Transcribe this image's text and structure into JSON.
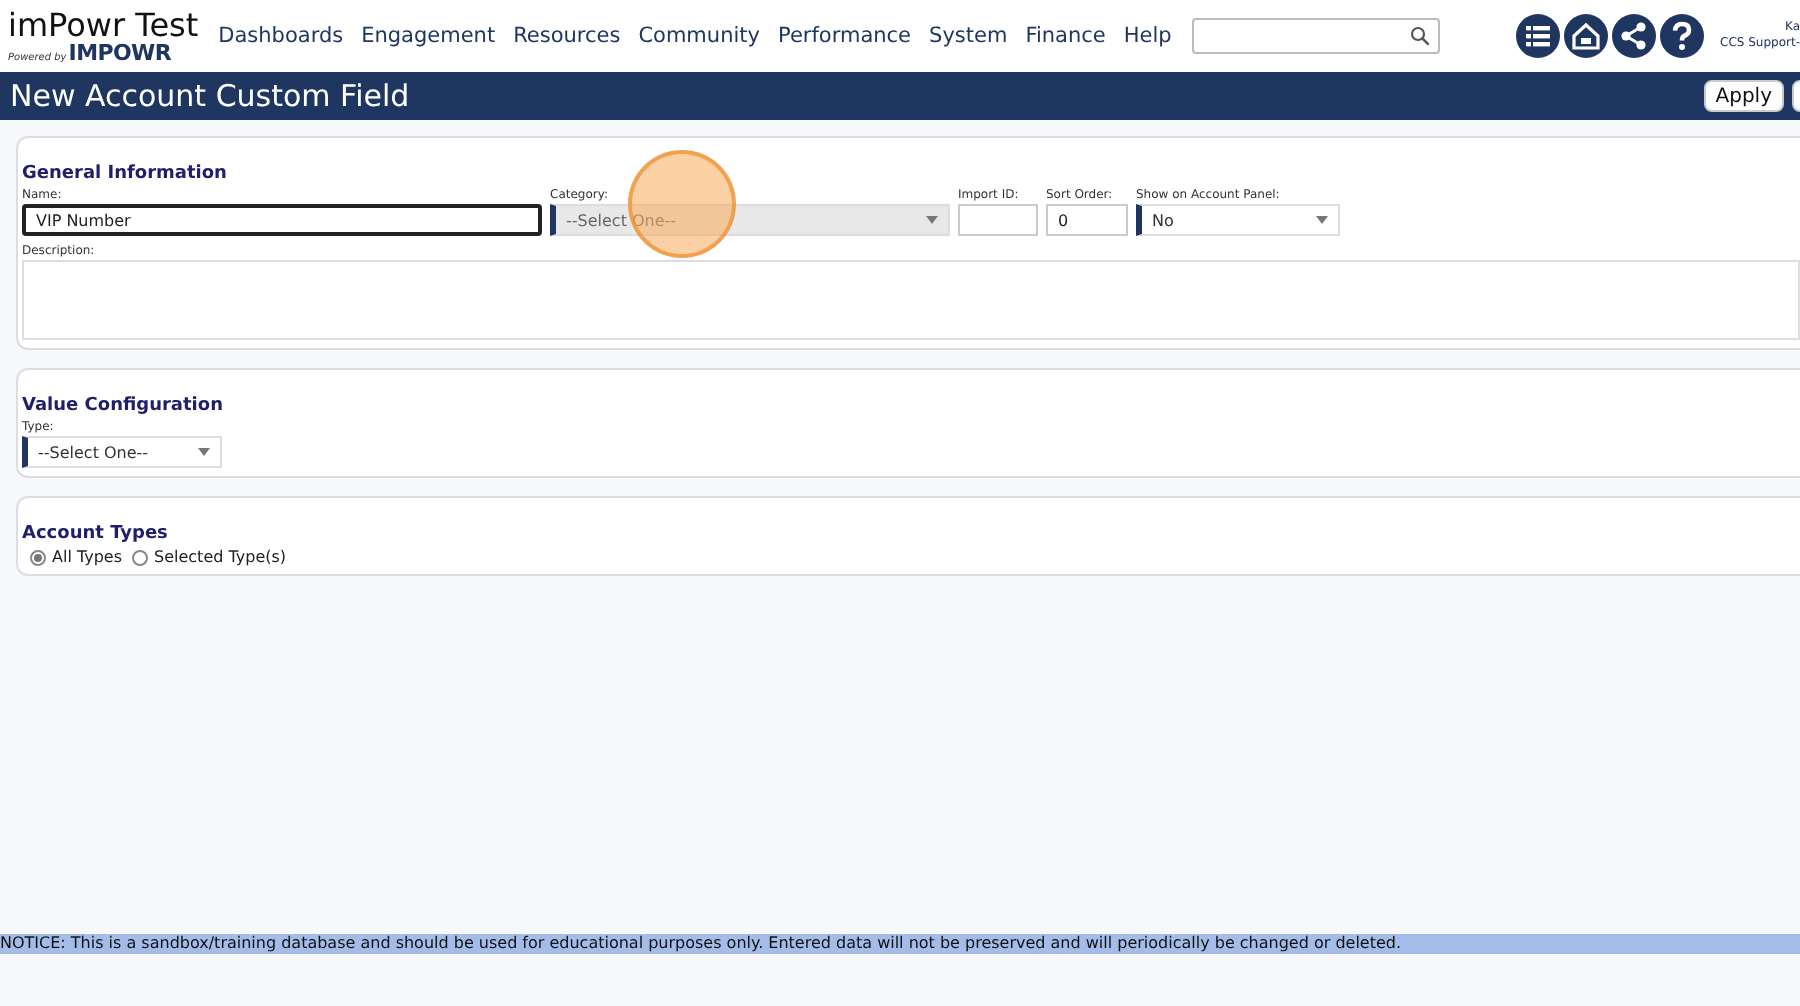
{
  "header": {
    "logo_title": "imPowr Test",
    "logo_powered_by": "Powered by",
    "logo_brand": "IMPOWR",
    "nav": [
      "Dashboards",
      "Engagement",
      "Resources",
      "Community",
      "Performance",
      "System",
      "Finance",
      "Help"
    ],
    "user": {
      "name": "Ka",
      "role": "CCS Support-"
    }
  },
  "title_bar": {
    "title": "New Account Custom Field",
    "actions": [
      "Apply"
    ]
  },
  "sections": [
    {
      "title": "General Information",
      "fields": [
        {
          "kind": "text",
          "label": "Name:",
          "value": "VIP Number",
          "focused": true
        },
        {
          "kind": "select",
          "label": "Category:",
          "value": "--Select One--",
          "disabled": true
        },
        {
          "kind": "text",
          "label": "Import ID:",
          "focused": false
        },
        {
          "kind": "text",
          "label": "Sort Order:",
          "value": "0",
          "focused": false
        },
        {
          "kind": "select",
          "label": "Show on Account Panel:",
          "value": "No",
          "disabled": false
        },
        {
          "kind": "textarea",
          "label": "Description:"
        }
      ]
    },
    {
      "title": "Value Configuration",
      "fields": [
        {
          "kind": "select",
          "label": "Type:",
          "value": "--Select One--",
          "disabled": false
        }
      ]
    },
    {
      "title": "Account Types",
      "fields": [
        {
          "kind": "radio",
          "options": [
            {
              "label": "All Types",
              "selected": true
            },
            {
              "label": "Selected Type(s)",
              "selected": false
            }
          ]
        }
      ]
    }
  ],
  "notice": "NOTICE: This is a sandbox/training database and should be used for educational purposes only. Entered data will not be preserved and will periodically be changed or deleted."
}
